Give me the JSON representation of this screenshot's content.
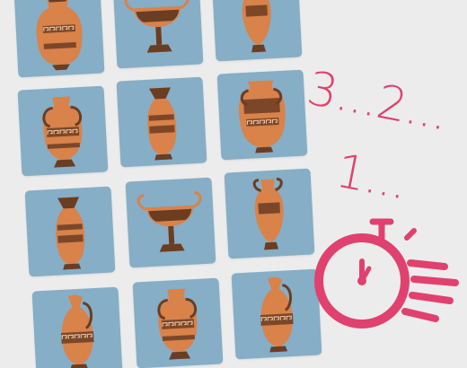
{
  "countdown": {
    "line1": "3...2...",
    "line2": "1..."
  },
  "colors": {
    "background": "#ececec",
    "card": "#86aec6",
    "accent": "#e0416e",
    "clay": "#d9824a",
    "dark": "#6b3d23"
  },
  "grid": {
    "cards": [
      {
        "vase": "amphora-wide"
      },
      {
        "vase": "kylix-cup"
      },
      {
        "vase": "slim-amphora"
      },
      {
        "vase": "handled-amphora"
      },
      {
        "vase": "tall-vase"
      },
      {
        "vase": "big-amphora"
      },
      {
        "vase": "tall-vase"
      },
      {
        "vase": "kylix-cup"
      },
      {
        "vase": "slim-amphora"
      },
      {
        "vase": "oinochoe-jug"
      },
      {
        "vase": "handled-amphora"
      },
      {
        "vase": "oinochoe-jug"
      }
    ]
  },
  "timer_icon": "stopwatch-icon"
}
